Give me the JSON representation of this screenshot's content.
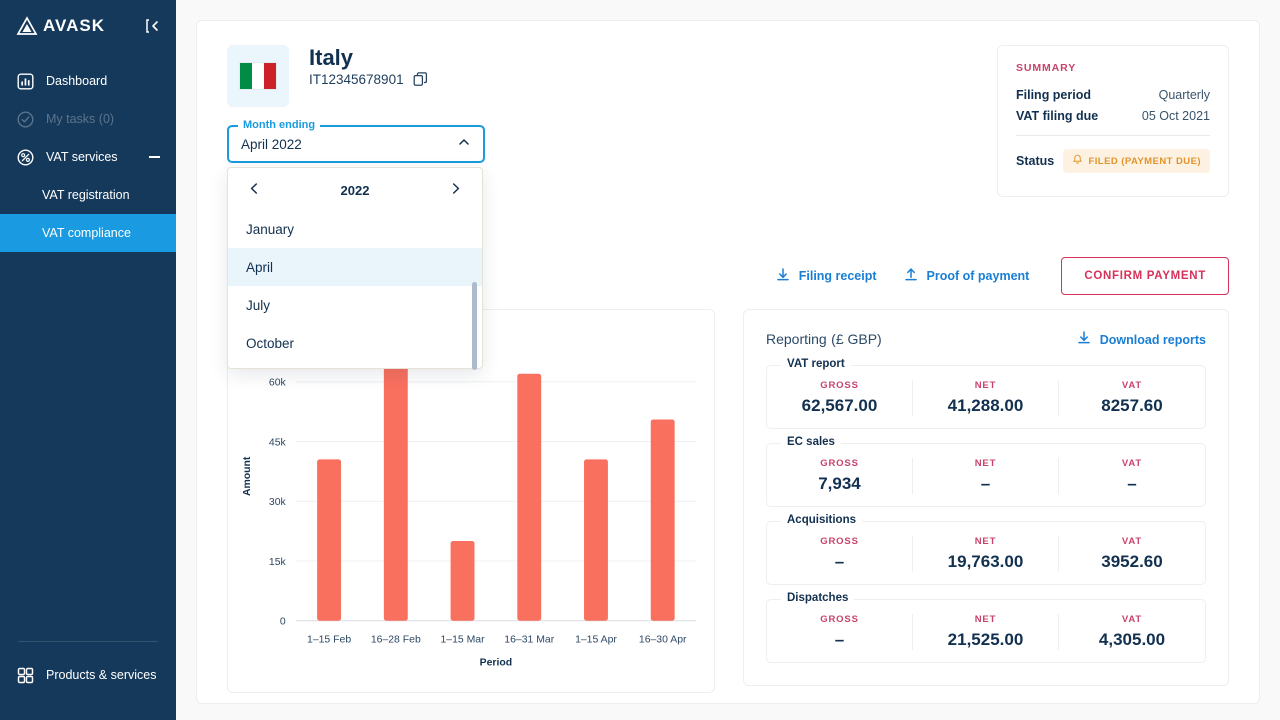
{
  "sidebar": {
    "brand": "AVASK",
    "collapse_icon": "collapse-panel-icon",
    "items": [
      {
        "label": "Dashboard",
        "icon": "dashboard-icon",
        "state": "normal"
      },
      {
        "label": "My tasks (0)",
        "icon": "check-circle-icon",
        "state": "disabled"
      },
      {
        "label": "VAT services",
        "icon": "percent-circle-icon",
        "state": "expanded"
      }
    ],
    "sub_items": [
      {
        "label": "VAT registration",
        "active": false
      },
      {
        "label": "VAT compliance",
        "active": true
      }
    ],
    "footer": {
      "label": "Products & services",
      "icon": "grid-icon"
    },
    "bg_color": "#15395b",
    "active_color": "#1a9ae0"
  },
  "header": {
    "country": "Italy",
    "vat_number": "IT12345678901",
    "copy_icon": "copy-icon",
    "flag": {
      "name": "italy-flag",
      "colors": [
        "#008c45",
        "#ffffff",
        "#cd212a"
      ]
    }
  },
  "month_select": {
    "legend": "Month ending",
    "value": "April 2022",
    "caret_icon": "chevron-up-icon",
    "open": true,
    "dropdown": {
      "prev_icon": "chevron-left-icon",
      "next_icon": "chevron-right-icon",
      "year": "2022",
      "options": [
        "January",
        "April",
        "July",
        "October"
      ],
      "selected": "April"
    }
  },
  "summary": {
    "title": "SUMMARY",
    "rows": [
      {
        "key": "Filing period",
        "value": "Quarterly"
      },
      {
        "key": "VAT filing due",
        "value": "05 Oct 2021"
      }
    ],
    "status_key": "Status",
    "status_badge": {
      "label": "FILED (PAYMENT DUE)",
      "icon": "bell-icon",
      "color": "#e2932c",
      "bg": "#fdf2e1"
    }
  },
  "actions": {
    "filing_receipt": {
      "label": "Filing receipt",
      "icon": "download-icon"
    },
    "proof_of_payment": {
      "label": "Proof of payment",
      "icon": "upload-icon"
    },
    "confirm_payment": {
      "label": "CONFIRM PAYMENT",
      "color": "#d6315b"
    }
  },
  "reporting": {
    "title": "Reporting",
    "currency": "(£ GBP)",
    "download": {
      "label": "Download reports",
      "icon": "download-icon"
    },
    "column_labels": [
      "GROSS",
      "NET",
      "VAT"
    ],
    "sections": [
      {
        "legend": "VAT report",
        "values": [
          "62,567.00",
          "41,288.00",
          "8257.60"
        ]
      },
      {
        "legend": "EC sales",
        "values": [
          "7,934",
          "–",
          "–"
        ]
      },
      {
        "legend": "Acquisitions",
        "values": [
          "–",
          "19,763.00",
          "3952.60"
        ]
      },
      {
        "legend": "Dispatches",
        "values": [
          "–",
          "21,525.00",
          "4,305.00"
        ]
      }
    ]
  },
  "chart_data": {
    "type": "bar",
    "title": "",
    "xlabel": "Period",
    "ylabel": "Amount",
    "categories": [
      "1–15 Feb",
      "16–28 Feb",
      "1–15 Mar",
      "16–31 Mar",
      "1–15 Apr",
      "16–30 Apr"
    ],
    "values": [
      40500,
      72000,
      20000,
      62000,
      40500,
      50500
    ],
    "ytick_labels": [
      "0",
      "15k",
      "30k",
      "45k",
      "60k"
    ],
    "ytick_values": [
      0,
      15000,
      30000,
      45000,
      60000
    ],
    "ylim": [
      0,
      72500
    ],
    "bar_color": "#f9705f",
    "grid": true,
    "legend": "none"
  }
}
